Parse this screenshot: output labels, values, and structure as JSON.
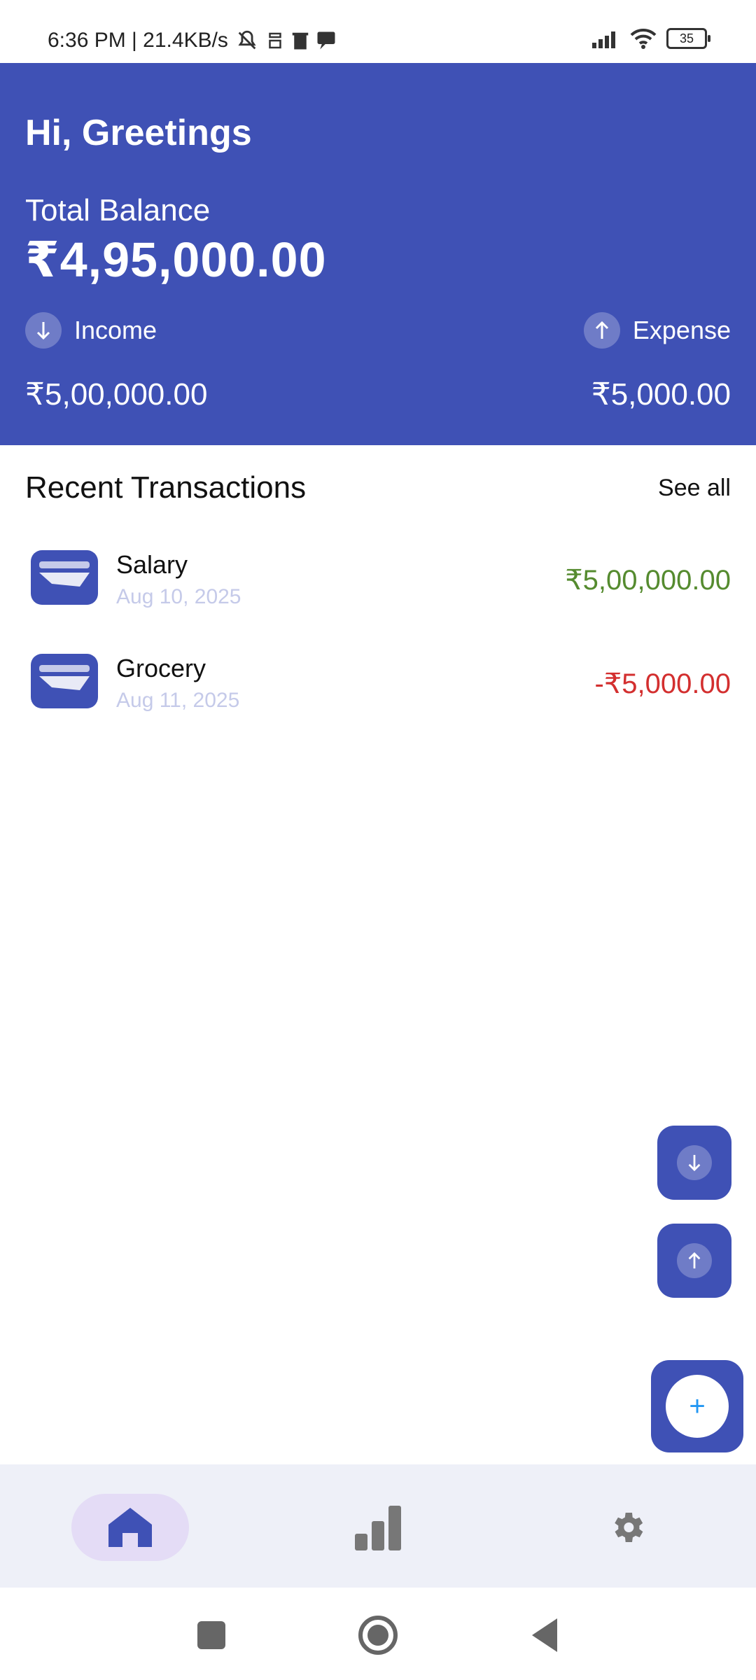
{
  "status_bar": {
    "time_speed": "6:36 PM | 21.4KB/s",
    "battery_level": "35",
    "icons": [
      "muted-bell-icon",
      "notification-icon",
      "trash-icon",
      "message-icon",
      "signal-icon",
      "wifi-icon",
      "battery-icon"
    ]
  },
  "header": {
    "greeting": "Hi, Greetings",
    "balance_label": "Total Balance",
    "balance_amount": "₹4,95,000.00",
    "income": {
      "label": "Income",
      "amount": "₹5,00,000.00",
      "icon": "arrow-down-icon"
    },
    "expense": {
      "label": "Expense",
      "amount": "₹5,000.00",
      "icon": "arrow-up-icon"
    },
    "background_color": "#3f51b5"
  },
  "recent": {
    "title": "Recent Transactions",
    "see_all": "See all",
    "transactions": [
      {
        "name": "Salary",
        "date": "Aug 10, 2025",
        "amount": "₹5,00,000.00",
        "type": "income",
        "color": "#558b2f"
      },
      {
        "name": "Grocery",
        "date": "Aug 11, 2025",
        "amount": "-₹5,000.00",
        "type": "expense",
        "color": "#d32f2f"
      }
    ]
  },
  "fabs": {
    "income_icon": "arrow-down-icon",
    "expense_icon": "arrow-up-icon",
    "add_label": "+"
  },
  "bottom_nav": {
    "items": [
      {
        "name": "home",
        "icon": "home-icon",
        "active": true
      },
      {
        "name": "stats",
        "icon": "bar-chart-icon",
        "active": false
      },
      {
        "name": "settings",
        "icon": "gear-icon",
        "active": false
      }
    ]
  },
  "system_nav": {
    "icons": [
      "recents-square-icon",
      "home-circle-icon",
      "back-triangle-icon"
    ]
  }
}
